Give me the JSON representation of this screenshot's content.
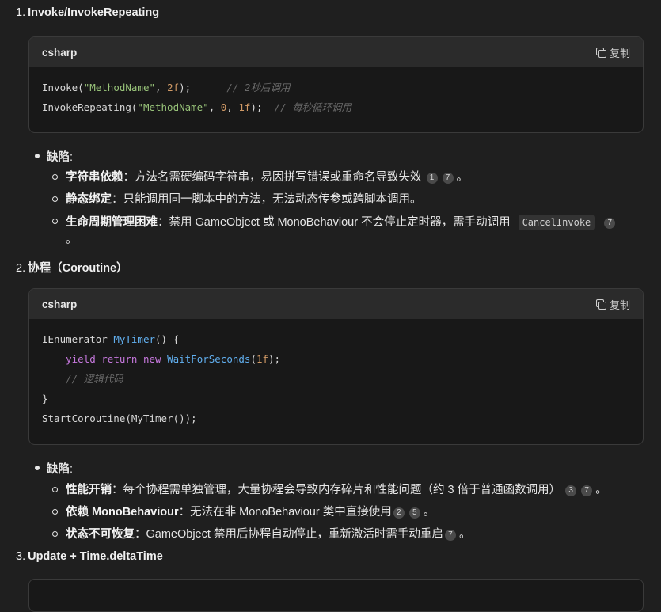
{
  "sections": [
    {
      "number": "1.",
      "title": "Invoke/InvokeRepeating",
      "code": {
        "lang": "csharp",
        "copy_label": "复制"
      },
      "defects_label": "缺陷",
      "items": [
        {
          "bold": "字符串依赖",
          "text": "：方法名需硬编码字符串，易因拼写错误或重命名导致失效",
          "cites": [
            "1",
            "7"
          ],
          "tail": "。"
        },
        {
          "bold": "静态绑定",
          "text": "：只能调用同一脚本中的方法，无法动态传参或跨脚本调用。"
        },
        {
          "bold": "生命周期管理困难",
          "text": "：禁用 GameObject 或 MonoBehaviour 不会停止定时器，需手动调用",
          "code": "CancelInvoke",
          "cites": [
            "7"
          ],
          "tail": "。"
        }
      ]
    },
    {
      "number": "2.",
      "title": "协程（Coroutine）",
      "code": {
        "lang": "csharp",
        "copy_label": "复制"
      },
      "defects_label": "缺陷",
      "items": [
        {
          "bold": "性能开销",
          "text": "：每个协程需单独管理，大量协程会导致内存碎片和性能问题（约 3 倍于普通函数调用）",
          "cites": [
            "3",
            "7"
          ],
          "tail": "。"
        },
        {
          "bold": "依赖 MonoBehaviour",
          "text": "：无法在非 MonoBehaviour 类中直接使用",
          "cites": [
            "2",
            "5"
          ],
          "tail": "。"
        },
        {
          "bold": "状态不可恢复",
          "text": "：GameObject 禁用后协程自动停止，重新激活时需手动重启",
          "cites": [
            "7"
          ],
          "tail": "。"
        }
      ]
    },
    {
      "number": "3.",
      "title": "Update + Time.deltaTime"
    }
  ],
  "code1": {
    "l1a": "Invoke(",
    "l1s": "\"MethodName\"",
    "l1b": ", ",
    "l1n": "2f",
    "l1c": ");      ",
    "l1cmt": "// 2秒后调用",
    "l2a": "InvokeRepeating(",
    "l2s": "\"MethodName\"",
    "l2b": ", ",
    "l2n1": "0",
    "l2c": ", ",
    "l2n2": "1f",
    "l2d": ");  ",
    "l2cmt": "// 每秒循环调用"
  },
  "code2": {
    "l1a": "IEnumerator ",
    "l1t": "MyTimer",
    "l1b": "() {",
    "l2k1": "yield",
    "l2k2": "return",
    "l2k3": "new",
    "l2t": "WaitForSeconds",
    "l2n": "1f",
    "l2b": ");",
    "l3cmt": "// 逻辑代码",
    "l4": "}",
    "l5": "StartCoroutine(MyTimer());"
  },
  "punct": {
    "colon": ":",
    "open": "(",
    "close": ")"
  }
}
